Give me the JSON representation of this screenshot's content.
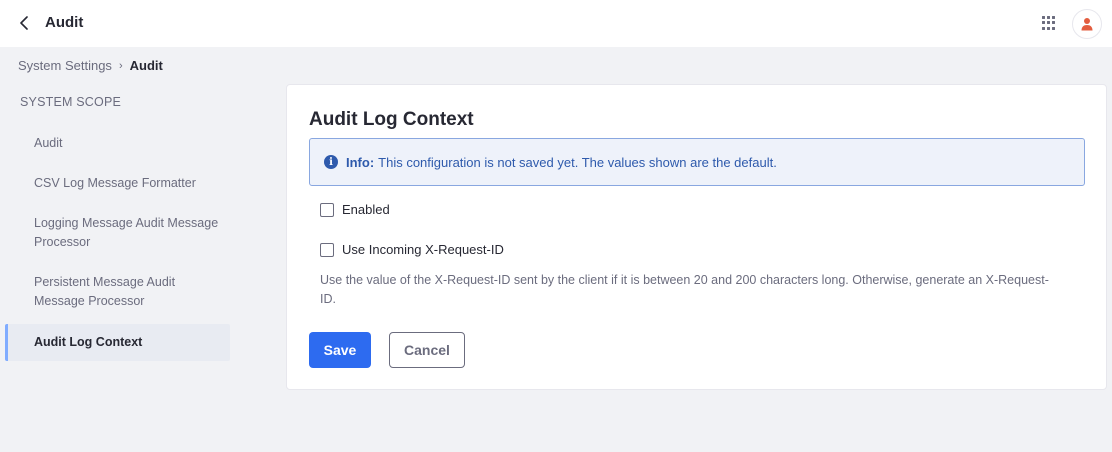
{
  "header": {
    "title": "Audit",
    "back_icon": "chevron-left-icon",
    "apps_icon": "grid-icon",
    "avatar_icon": "user-icon"
  },
  "breadcrumb": {
    "parent": "System Settings",
    "separator": "›",
    "current": "Audit"
  },
  "sidebar": {
    "scope_title": "SYSTEM SCOPE",
    "items": [
      {
        "label": "Audit"
      },
      {
        "label": "CSV Log Message Formatter"
      },
      {
        "label": "Logging Message Audit Message Processor"
      },
      {
        "label": "Persistent Message Audit Message Processor"
      },
      {
        "label": "Audit Log Context",
        "active": true
      }
    ]
  },
  "main": {
    "title": "Audit Log Context",
    "info": {
      "label": "Info:",
      "message": "This configuration is not saved yet. The values shown are the default."
    },
    "fields": [
      {
        "label": "Enabled",
        "checked": false
      },
      {
        "label": "Use Incoming X-Request-ID",
        "checked": false
      }
    ],
    "help_text": "Use the value of the X-Request-ID sent by the client if it is between 20 and 200 characters long. Otherwise, generate an X-Request-ID.",
    "save_label": "Save",
    "cancel_label": "Cancel"
  },
  "colors": {
    "primary": "#2d6bf0",
    "info_text": "#2e5aac",
    "info_bg": "#eef2fa",
    "avatar_accent": "#e35d3f",
    "active_border": "#80acff"
  }
}
